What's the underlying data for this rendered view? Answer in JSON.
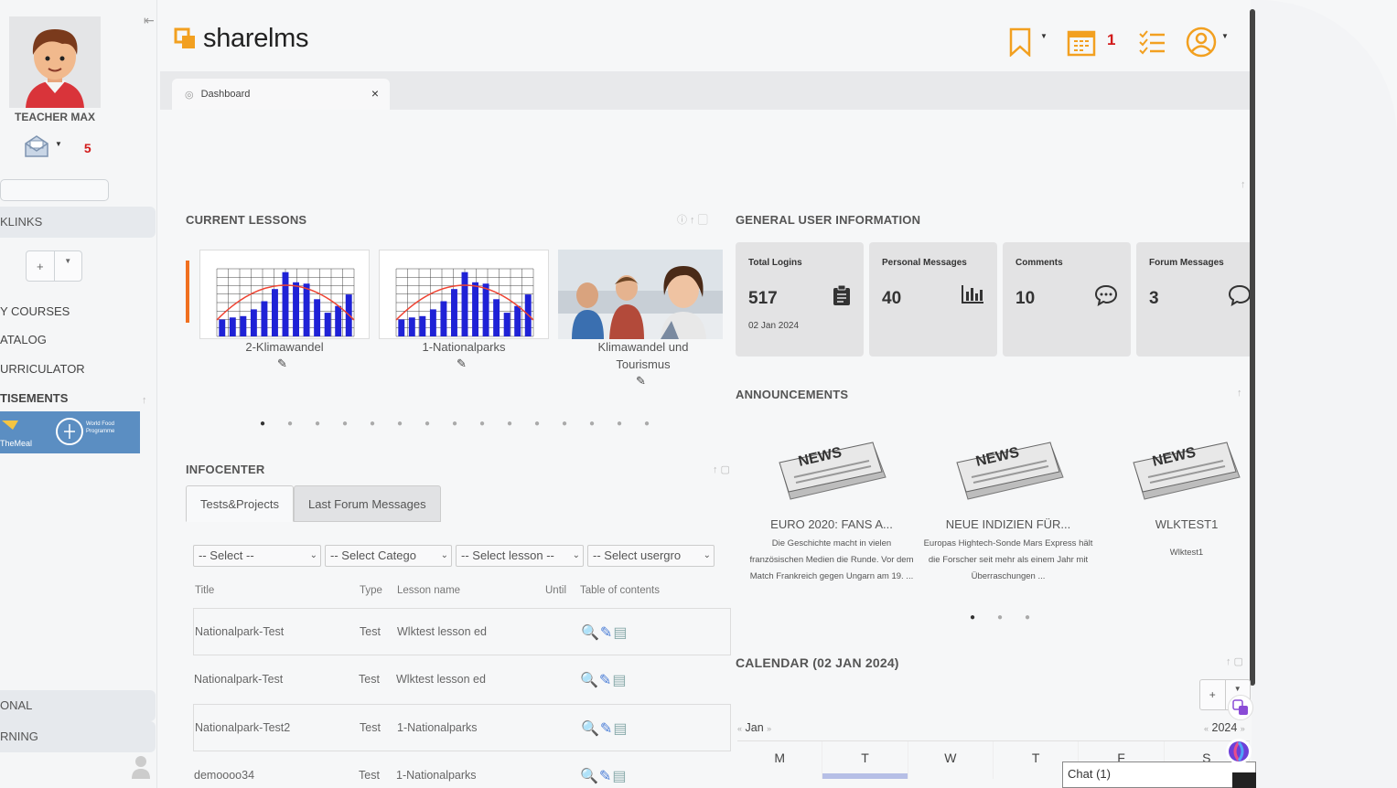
{
  "sidebar": {
    "user_name": "TEACHER MAX",
    "notification_count": "5",
    "items": {
      "links": "KLINKS",
      "add": "+",
      "my_courses": "Y COURSES",
      "catalog": "ATALOG",
      "curriculator": "URRICULATOR",
      "advertisements": "TISEMENTS",
      "personal": "ONAL",
      "learning": "RNING"
    },
    "banner": {
      "left_text": "TheMeal",
      "right_text": "World Food Programme"
    }
  },
  "header": {
    "logo": "sharelms",
    "calendar_count": "1"
  },
  "tabs": [
    {
      "label": "Dashboard",
      "close": "×"
    }
  ],
  "current_lessons": {
    "title": "CURRENT LESSONS",
    "items": [
      {
        "label": "2-Klimawandel"
      },
      {
        "label": "1-Nationalparks"
      },
      {
        "label": "Klimawandel und Tourismus"
      }
    ],
    "bar_values": [
      0.25,
      0.28,
      0.3,
      0.4,
      0.52,
      0.7,
      0.95,
      0.8,
      0.78,
      0.55,
      0.35,
      0.45,
      0.62
    ]
  },
  "user_info": {
    "title": "GENERAL USER INFORMATION",
    "cards": [
      {
        "label": "Total Logins",
        "value": "517",
        "date": "02 Jan 2024",
        "icon": "clipboard-icon"
      },
      {
        "label": "Personal Messages",
        "value": "40",
        "icon": "bar-chart-icon"
      },
      {
        "label": "Comments",
        "value": "10",
        "icon": "comment-icon"
      },
      {
        "label": "Forum Messages",
        "value": "3",
        "icon": "comment-icon"
      }
    ]
  },
  "announcements": {
    "title": "ANNOUNCEMENTS",
    "items": [
      {
        "title": "EURO 2020: FANS A...",
        "text": "Die Geschichte macht in vielen französischen Medien die Runde. Vor dem Match Frankreich gegen Ungarn am 19. ..."
      },
      {
        "title": "NEUE INDIZIEN FÜR...",
        "text": "Europas Hightech-Sonde Mars Express hält die Forscher seit mehr als einem Jahr mit Überraschungen ..."
      },
      {
        "title": "WLKTEST1",
        "text": "Wlktest1"
      }
    ],
    "news_word": "NEWS"
  },
  "infocenter": {
    "title": "INFOCENTER",
    "tabs": [
      "Tests&Projects",
      "Last Forum Messages"
    ],
    "filters": [
      "-- Select --",
      "-- Select Catego",
      "-- Select lesson --",
      "-- Select usergro"
    ],
    "columns": [
      "Title",
      "Type",
      "Lesson name",
      "Until",
      "Table of contents"
    ],
    "rows": [
      {
        "title": "Nationalpark-Test",
        "type": "Test",
        "lesson": "Wlktest lesson ed"
      },
      {
        "title": "Nationalpark-Test",
        "type": "Test",
        "lesson": "Wlktest lesson ed"
      },
      {
        "title": "Nationalpark-Test2",
        "type": "Test",
        "lesson": "1-Nationalparks"
      },
      {
        "title": "demoooo34",
        "type": "Test",
        "lesson": "1-Nationalparks"
      }
    ]
  },
  "calendar": {
    "title": "CALENDAR (02 JAN 2024)",
    "add": "+",
    "month": "Jan",
    "year": "2024",
    "days": [
      "M",
      "T",
      "W",
      "T",
      "F",
      "S"
    ]
  },
  "chat": {
    "label": "Chat (1)"
  },
  "colors": {
    "accent": "#f2a020",
    "danger": "#d21b1b",
    "bar_blue": "#1f22d6"
  }
}
